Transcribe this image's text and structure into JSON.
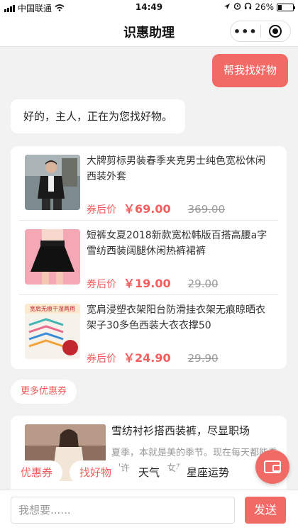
{
  "status": {
    "carrier": "中国联通",
    "time": "14:49",
    "battery": "26%",
    "battery_level": 0.26
  },
  "nav": {
    "title": "识惠助理",
    "more": "•••"
  },
  "chat": {
    "user_message": "帮我找好物",
    "bot_reply": "好的，主人，正在为您找好物。",
    "goods": [
      {
        "title": "大牌剪标男装春季夹克男士纯色宽松休闲西装外套",
        "coupon_label": "券后价",
        "price_now": "￥69.00",
        "price_old": "369.00"
      },
      {
        "title": "短裤女夏2018新款宽松韩版百搭高腰a字雪纺西装阔腿休闲热裤裙裤",
        "coupon_label": "券后价",
        "price_now": "￥19.00",
        "price_old": "29.00"
      },
      {
        "title": "宽肩浸塑衣架阳台防滑挂衣架无痕晾晒衣架子30多色西装大衣衣撑50",
        "coupon_label": "券后价",
        "price_now": "￥24.90",
        "price_old": "29.90",
        "image_text": "宽肩无痕干湿两用"
      }
    ],
    "more_coupons": "更多优惠券",
    "article": {
      "title": "雪纺衬衫搭西装裤，尽显职场",
      "desc": "夏季，本就是美的季节。现在每天都能看到许多美丽的女孩，内容..."
    }
  },
  "quick_actions": [
    "优惠券",
    "找好物",
    "天气",
    "星座运势"
  ],
  "input": {
    "placeholder": "我想要......",
    "send_label": "发送"
  }
}
